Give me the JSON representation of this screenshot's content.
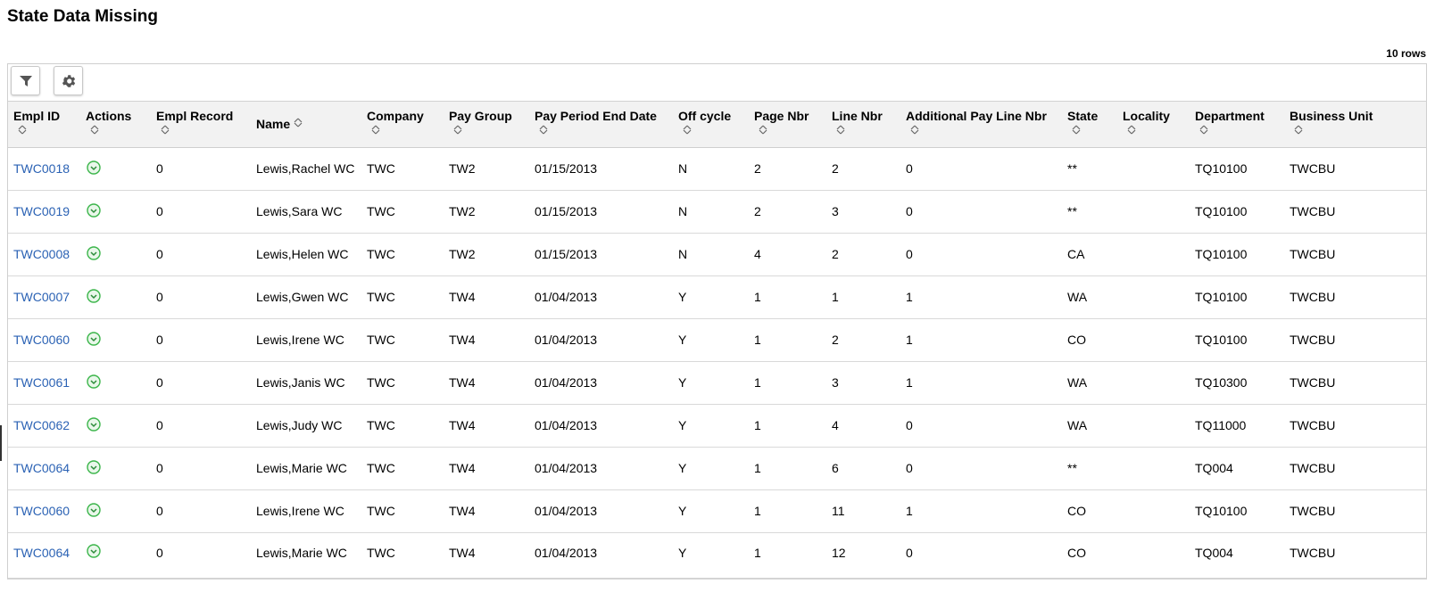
{
  "page": {
    "title": "State Data Missing",
    "row_count": "10 rows"
  },
  "toolbar": {
    "filter_icon": "filter-icon",
    "settings_icon": "gear-icon"
  },
  "columns": [
    "Empl ID",
    "Actions",
    "Empl Record",
    "Name",
    "Company",
    "Pay Group",
    "Pay Period End Date",
    "Off cycle",
    "Page Nbr",
    "Line Nbr",
    "Additional Pay Line Nbr",
    "State",
    "Locality",
    "Department",
    "Business Unit"
  ],
  "rows": [
    {
      "empl_id": "TWC0018",
      "empl_record": "0",
      "name": "Lewis,Rachel WC",
      "company": "TWC",
      "pay_group": "TW2",
      "end_date": "01/15/2013",
      "off_cycle": "N",
      "page_nbr": "2",
      "line_nbr": "2",
      "add_line": "0",
      "state": "**",
      "locality": "",
      "department": "TQ10100",
      "business_unit": "TWCBU"
    },
    {
      "empl_id": "TWC0019",
      "empl_record": "0",
      "name": "Lewis,Sara WC",
      "company": "TWC",
      "pay_group": "TW2",
      "end_date": "01/15/2013",
      "off_cycle": "N",
      "page_nbr": "2",
      "line_nbr": "3",
      "add_line": "0",
      "state": "**",
      "locality": "",
      "department": "TQ10100",
      "business_unit": "TWCBU"
    },
    {
      "empl_id": "TWC0008",
      "empl_record": "0",
      "name": "Lewis,Helen WC",
      "company": "TWC",
      "pay_group": "TW2",
      "end_date": "01/15/2013",
      "off_cycle": "N",
      "page_nbr": "4",
      "line_nbr": "2",
      "add_line": "0",
      "state": "CA",
      "locality": "",
      "department": "TQ10100",
      "business_unit": "TWCBU"
    },
    {
      "empl_id": "TWC0007",
      "empl_record": "0",
      "name": "Lewis,Gwen WC",
      "company": "TWC",
      "pay_group": "TW4",
      "end_date": "01/04/2013",
      "off_cycle": "Y",
      "page_nbr": "1",
      "line_nbr": "1",
      "add_line": "1",
      "state": "WA",
      "locality": "",
      "department": "TQ10100",
      "business_unit": "TWCBU"
    },
    {
      "empl_id": "TWC0060",
      "empl_record": "0",
      "name": "Lewis,Irene WC",
      "company": "TWC",
      "pay_group": "TW4",
      "end_date": "01/04/2013",
      "off_cycle": "Y",
      "page_nbr": "1",
      "line_nbr": "2",
      "add_line": "1",
      "state": "CO",
      "locality": "",
      "department": "TQ10100",
      "business_unit": "TWCBU"
    },
    {
      "empl_id": "TWC0061",
      "empl_record": "0",
      "name": "Lewis,Janis WC",
      "company": "TWC",
      "pay_group": "TW4",
      "end_date": "01/04/2013",
      "off_cycle": "Y",
      "page_nbr": "1",
      "line_nbr": "3",
      "add_line": "1",
      "state": "WA",
      "locality": "",
      "department": "TQ10300",
      "business_unit": "TWCBU"
    },
    {
      "empl_id": "TWC0062",
      "empl_record": "0",
      "name": "Lewis,Judy WC",
      "company": "TWC",
      "pay_group": "TW4",
      "end_date": "01/04/2013",
      "off_cycle": "Y",
      "page_nbr": "1",
      "line_nbr": "4",
      "add_line": "0",
      "state": "WA",
      "locality": "",
      "department": "TQ11000",
      "business_unit": "TWCBU"
    },
    {
      "empl_id": "TWC0064",
      "empl_record": "0",
      "name": "Lewis,Marie WC",
      "company": "TWC",
      "pay_group": "TW4",
      "end_date": "01/04/2013",
      "off_cycle": "Y",
      "page_nbr": "1",
      "line_nbr": "6",
      "add_line": "0",
      "state": "**",
      "locality": "",
      "department": "TQ004",
      "business_unit": "TWCBU"
    },
    {
      "empl_id": "TWC0060",
      "empl_record": "0",
      "name": "Lewis,Irene WC",
      "company": "TWC",
      "pay_group": "TW4",
      "end_date": "01/04/2013",
      "off_cycle": "Y",
      "page_nbr": "1",
      "line_nbr": "11",
      "add_line": "1",
      "state": "CO",
      "locality": "",
      "department": "TQ10100",
      "business_unit": "TWCBU"
    },
    {
      "empl_id": "TWC0064",
      "empl_record": "0",
      "name": "Lewis,Marie WC",
      "company": "TWC",
      "pay_group": "TW4",
      "end_date": "01/04/2013",
      "off_cycle": "Y",
      "page_nbr": "1",
      "line_nbr": "12",
      "add_line": "0",
      "state": "CO",
      "locality": "",
      "department": "TQ004",
      "business_unit": "TWCBU"
    }
  ],
  "colors": {
    "link": "#2b62b4",
    "action_green": "#3bb54a",
    "header_bg": "#f2f2f2"
  }
}
